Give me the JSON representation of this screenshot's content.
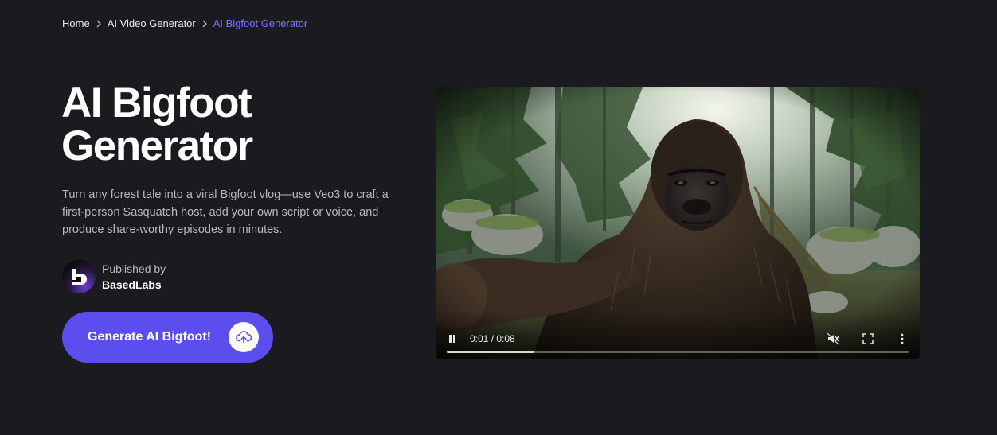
{
  "breadcrumb": {
    "items": [
      {
        "label": "Home"
      },
      {
        "label": "AI Video Generator"
      },
      {
        "label": "AI Bigfoot Generator"
      }
    ],
    "separator_icon": "chevron-right-icon",
    "active_color": "#7b74ff"
  },
  "hero": {
    "title": "AI Bigfoot Generator",
    "description": "Turn any forest tale into a viral Bigfoot vlog—use Veo3 to craft a first-person Sasquatch host, add your own script or voice, and produce share-worthy episodes in minutes."
  },
  "publisher": {
    "label": "Published by",
    "name": "BasedLabs",
    "avatar_icon": "basedlabs-logo-icon"
  },
  "cta": {
    "label": "Generate AI Bigfoot!",
    "icon": "cloud-upload-icon",
    "color": "#5b4dee"
  },
  "video": {
    "time": "0:01 / 0:08",
    "progress_fraction": 0.19,
    "controls": {
      "play_state_icon": "pause-icon",
      "mute_icon": "volume-muted-icon",
      "fullscreen_icon": "fullscreen-icon",
      "more_icon": "more-vertical-icon"
    }
  },
  "colors": {
    "background": "#1b1a1f",
    "text_muted": "#b9b8c2"
  }
}
